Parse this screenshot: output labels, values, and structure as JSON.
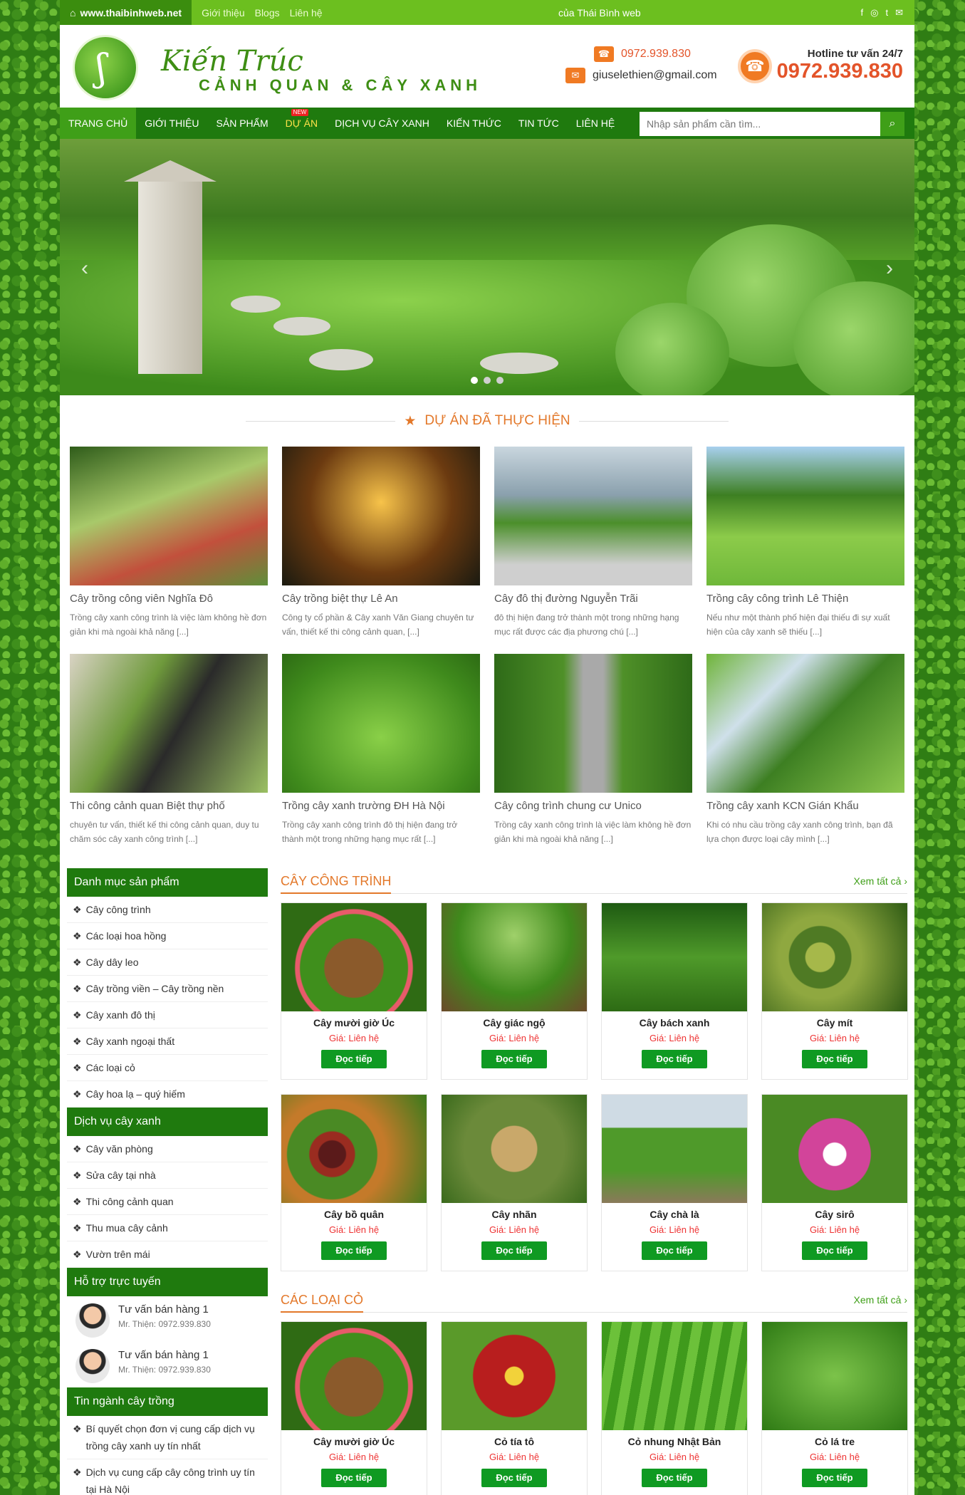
{
  "topbar": {
    "site": "www.thaibinhweb.net",
    "links": [
      "Giới thiệu",
      "Blogs",
      "Liên hệ"
    ],
    "credit": "của Thái Bình web",
    "social": [
      "f",
      "◎",
      "t",
      "✉"
    ]
  },
  "header": {
    "logo_script": "Kiến Trúc",
    "logo_sub": "CẢNH QUAN & CÂY XANH",
    "phone": "0972.939.830",
    "email": "giuselethien@gmail.com",
    "hotline_label": "Hotline tư vấn 24/7",
    "hotline": "0972.939.830"
  },
  "nav": {
    "items": [
      "TRANG CHỦ",
      "GIỚI THIỆU",
      "SẢN PHẨM",
      "DỰ ÁN",
      "DỊCH VỤ CÂY XANH",
      "KIẾN THỨC",
      "TIN TỨC",
      "LIÊN HỆ"
    ],
    "new_badge": "NEW",
    "search_placeholder": "Nhập sản phẩm cần tìm..."
  },
  "projects_title": "DỰ ÁN ĐÃ THỰC HIỆN",
  "projects": [
    {
      "title": "Cây trồng công viên Nghĩa Đô",
      "desc": "Trồng cây xanh công trình là việc làm không hề đơn giản khi mà ngoài khả năng [...]"
    },
    {
      "title": "Cây trồng biệt thự Lê An",
      "desc": "Công ty cổ phần & Cây xanh Văn Giang chuyên tư vấn, thiết kế thi công cảnh quan, [...]"
    },
    {
      "title": "Cây đô thị đường Nguyễn Trãi",
      "desc": "đô thị hiện đang trở thành một trong những hạng mục rất được các địa phương chú [...]"
    },
    {
      "title": "Trồng cây công trình Lê Thiện",
      "desc": "Nếu như một thành phố hiện đại thiếu đi sự xuất hiện của cây xanh sẽ thiếu [...]"
    },
    {
      "title": "Thi công cảnh quan Biệt thự phố",
      "desc": "chuyên tư vấn, thiết kế thi công cảnh quan, duy tu chăm sóc cây xanh công trình [...]"
    },
    {
      "title": "Trồng cây xanh trường ĐH Hà Nội",
      "desc": "Trồng cây xanh công trình đô thị hiện đang trở thành một trong những hạng mục rất [...]"
    },
    {
      "title": "Cây công trình chung cư Unico",
      "desc": "Trồng cây xanh công trình là việc làm không hề đơn giản khi mà ngoài khả năng [...]"
    },
    {
      "title": "Trồng cây xanh KCN Gián Khẩu",
      "desc": "Khi có nhu cầu trồng cây xanh công trình, bạn đã lựa chọn được loại cây mình [...]"
    }
  ],
  "sidebar": {
    "cat_title": "Danh mục sản phẩm",
    "cats": [
      "Cây công trình",
      "Các loại hoa hồng",
      "Cây dây leo",
      "Cây trồng viền – Cây trồng nền",
      "Cây xanh đô thị",
      "Cây xanh ngoại thất",
      "Các loại cỏ",
      "Cây hoa lạ – quý hiếm"
    ],
    "svc_title": "Dịch vụ cây xanh",
    "svcs": [
      "Cây văn phòng",
      "Sửa cây tại nhà",
      "Thi công cảnh quan",
      "Thu mua cây cảnh",
      "Vườn trên mái"
    ],
    "support_title": "Hỗ trợ trực tuyến",
    "support": [
      {
        "name": "Tư vấn bán hàng 1",
        "phone": "Mr. Thiện: 0972.939.830"
      },
      {
        "name": "Tư vấn bán hàng 1",
        "phone": "Mr. Thiện: 0972.939.830"
      }
    ],
    "news_title": "Tin ngành cây trồng",
    "news": [
      "Bí quyết chọn đơn vị cung cấp dịch vụ trồng cây xanh uy tín nhất",
      "Dịch vụ cung cấp cây công trình uy tín tại Hà Nội"
    ]
  },
  "sections": [
    {
      "title": "CÂY CÔNG TRÌNH",
      "see_all": "Xem tất cả",
      "items": [
        {
          "name": "Cây mười giờ Úc",
          "price_label": "Giá:",
          "price": "Liên hệ",
          "btn": "Đọc tiếp"
        },
        {
          "name": "Cây giác ngộ",
          "price_label": "Giá:",
          "price": "Liên hệ",
          "btn": "Đọc tiếp"
        },
        {
          "name": "Cây bách xanh",
          "price_label": "Giá:",
          "price": "Liên hệ",
          "btn": "Đọc tiếp"
        },
        {
          "name": "Cây mít",
          "price_label": "Giá:",
          "price": "Liên hệ",
          "btn": "Đọc tiếp"
        },
        {
          "name": "Cây bồ quân",
          "price_label": "Giá:",
          "price": "Liên hệ",
          "btn": "Đọc tiếp"
        },
        {
          "name": "Cây nhãn",
          "price_label": "Giá:",
          "price": "Liên hệ",
          "btn": "Đọc tiếp"
        },
        {
          "name": "Cây chà là",
          "price_label": "Giá:",
          "price": "Liên hệ",
          "btn": "Đọc tiếp"
        },
        {
          "name": "Cây sirô",
          "price_label": "Giá:",
          "price": "Liên hệ",
          "btn": "Đọc tiếp"
        }
      ]
    },
    {
      "title": "CÁC LOẠI CỎ",
      "see_all": "Xem tất cả",
      "items": [
        {
          "name": "Cây mười giờ Úc",
          "price_label": "Giá:",
          "price": "Liên hệ",
          "btn": "Đọc tiếp"
        },
        {
          "name": "Cỏ tía tô",
          "price_label": "Giá:",
          "price": "Liên hệ",
          "btn": "Đọc tiếp"
        },
        {
          "name": "Cỏ nhung Nhật Bản",
          "price_label": "Giá:",
          "price": "Liên hệ",
          "btn": "Đọc tiếp"
        },
        {
          "name": "Cỏ lá tre",
          "price_label": "Giá:",
          "price": "Liên hệ",
          "btn": "Đọc tiếp"
        }
      ]
    }
  ]
}
